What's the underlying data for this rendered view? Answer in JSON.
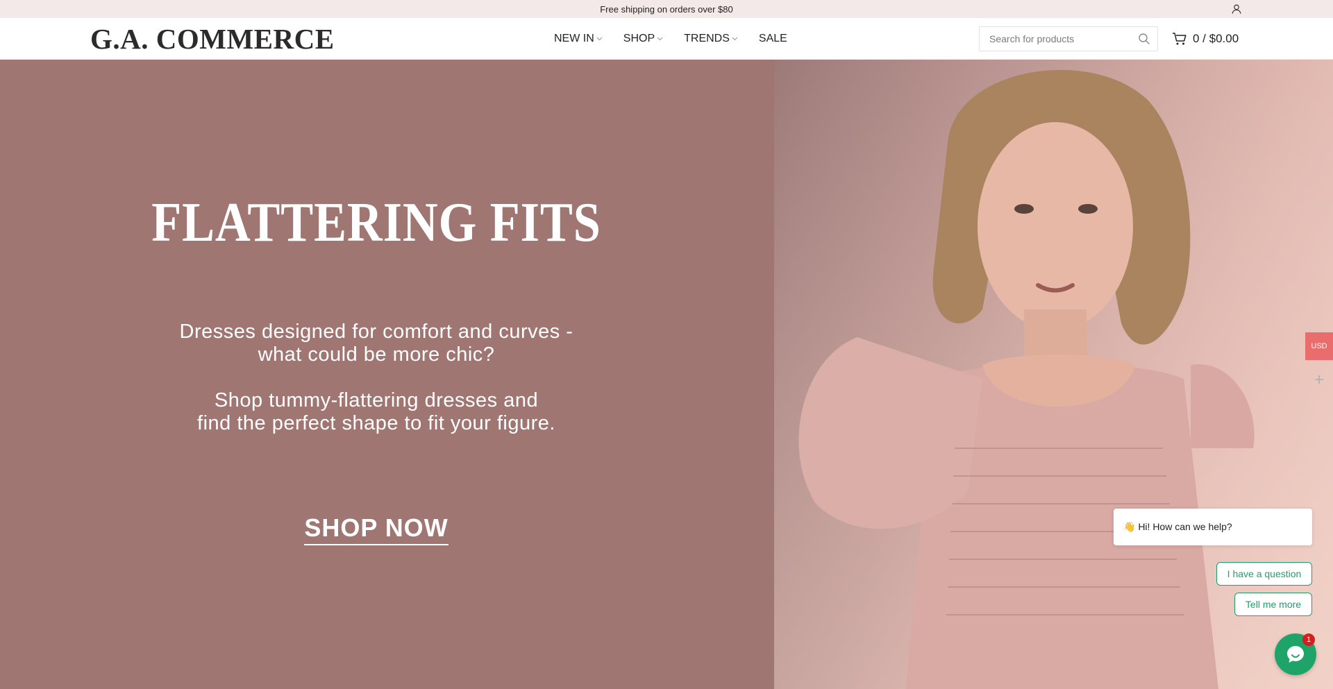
{
  "announcement": {
    "text": "Free shipping on orders over $80"
  },
  "header": {
    "logo": "G.A. COMMERCE",
    "nav": [
      {
        "label": "NEW IN",
        "has_dropdown": true
      },
      {
        "label": "SHOP",
        "has_dropdown": true
      },
      {
        "label": "TRENDS",
        "has_dropdown": true
      },
      {
        "label": "SALE",
        "has_dropdown": false
      }
    ],
    "search": {
      "placeholder": "Search for products",
      "value": ""
    },
    "cart": {
      "label": "0 / $0.00"
    },
    "icons": {
      "account": "user-icon",
      "search": "search-icon",
      "cart": "cart-icon"
    }
  },
  "hero": {
    "title": "FLATTERING FITS",
    "line1": "Dresses designed for comfort and curves -",
    "line2": "what could be more chic?",
    "line3": "Shop tummy-flattering dresses and",
    "line4": "find the perfect shape to fit your figure.",
    "cta": "SHOP NOW",
    "background_color": "#a07673"
  },
  "currency": {
    "label": "USD",
    "color": "#ea6d6d"
  },
  "chat": {
    "greeting": "👋 Hi! How can we help?",
    "options": [
      "I have a question",
      "Tell me more"
    ],
    "badge": "1",
    "accent": "#1ea469"
  }
}
